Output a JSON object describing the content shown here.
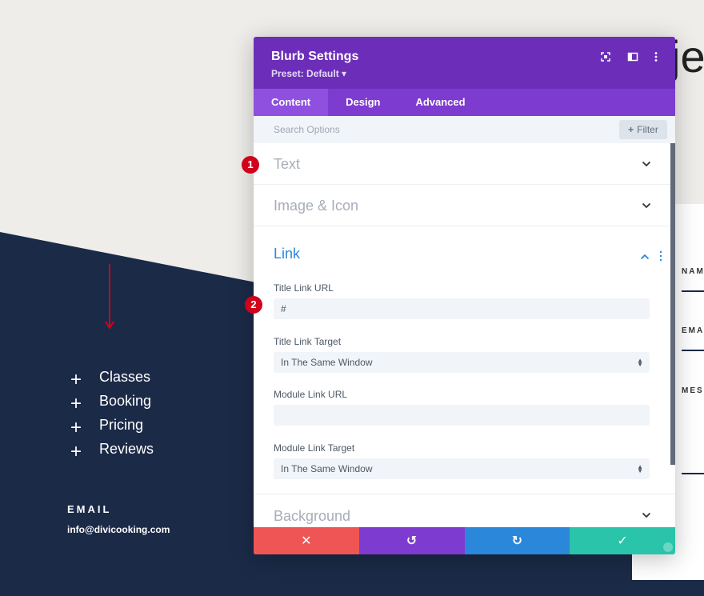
{
  "background_page": {
    "headline_fragment": "je",
    "menu_items": [
      "Classes",
      "Booking",
      "Pricing",
      "Reviews"
    ],
    "email_label": "EMAIL",
    "email_value": "info@divicooking.com",
    "form_labels": [
      "NAM",
      "EMA",
      "MES"
    ]
  },
  "modal": {
    "title": "Blurb Settings",
    "preset": "Preset: Default ▾",
    "tabs": [
      {
        "label": "Content",
        "active": true
      },
      {
        "label": "Design",
        "active": false
      },
      {
        "label": "Advanced",
        "active": false
      }
    ],
    "search_placeholder": "Search Options",
    "filter_label": "Filter",
    "sections": {
      "text": "Text",
      "image_icon": "Image & Icon",
      "link": "Link",
      "background": "Background"
    },
    "link_fields": {
      "title_link_url_label": "Title Link URL",
      "title_link_url_value": "#",
      "title_link_target_label": "Title Link Target",
      "title_link_target_value": "In The Same Window",
      "module_link_url_label": "Module Link URL",
      "module_link_url_value": "",
      "module_link_target_label": "Module Link Target",
      "module_link_target_value": "In The Same Window"
    },
    "footer": {
      "cancel": "✕",
      "undo": "↺",
      "redo": "↻",
      "save": "✓"
    }
  },
  "annotations": {
    "badge_1": "1",
    "badge_2": "2"
  },
  "colors": {
    "header_purple": "#6c2eb9",
    "tab_purple": "#7e3bd0",
    "link_blue": "#2b87da",
    "cancel_red": "#ef5555",
    "save_green": "#29c4a9",
    "navy": "#1b2a47",
    "badge_red": "#d0021b"
  }
}
